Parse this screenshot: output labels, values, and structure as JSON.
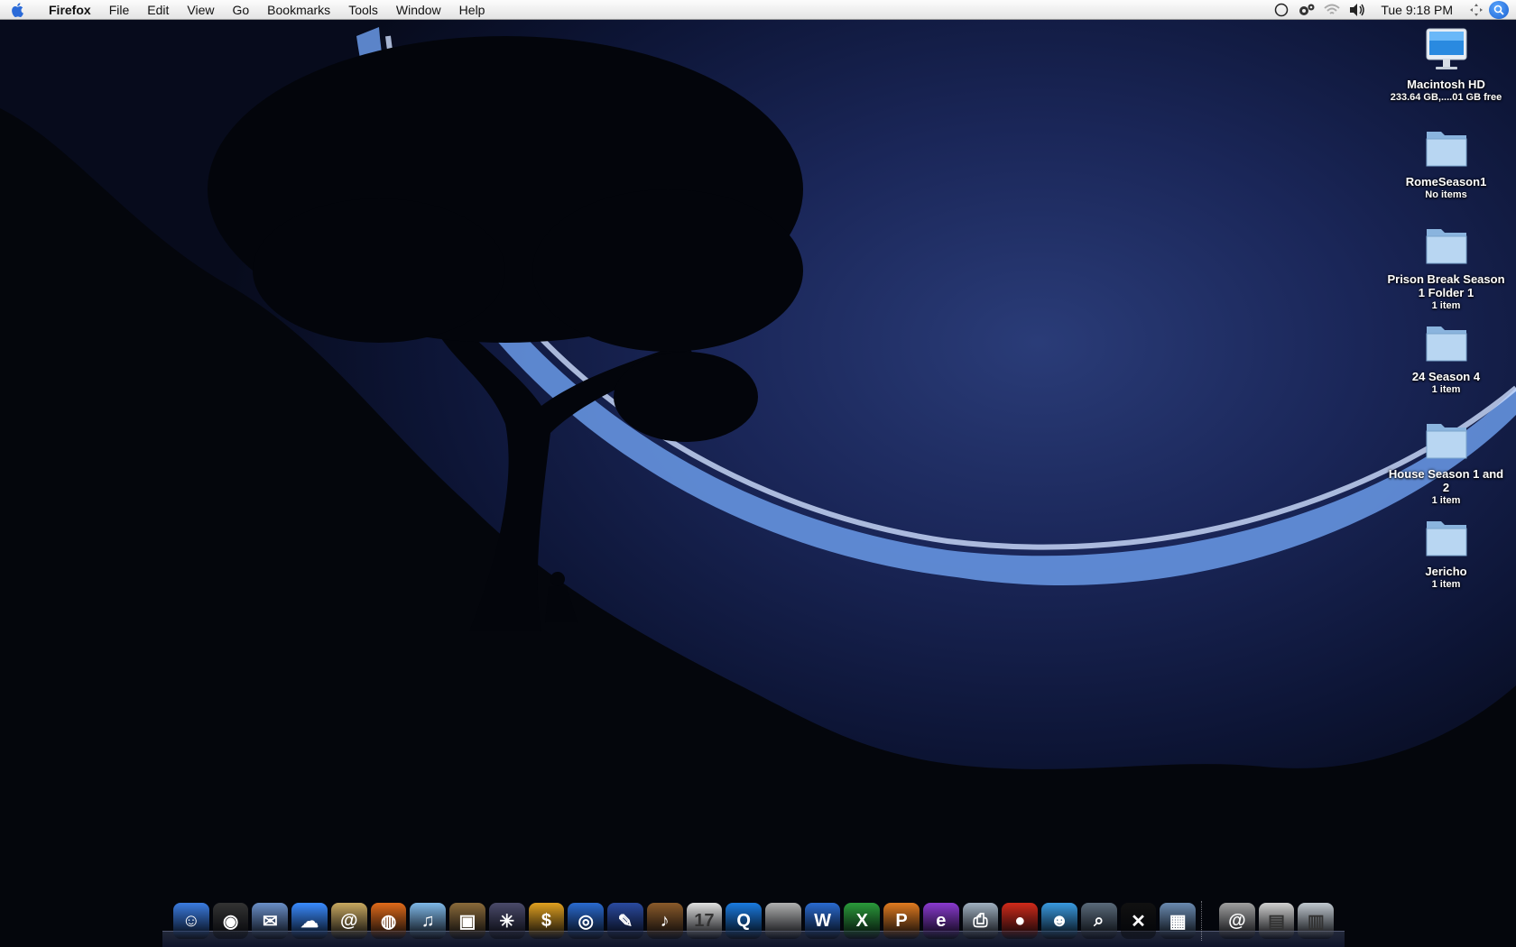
{
  "menubar": {
    "app_name": "Firefox",
    "menus": [
      "File",
      "Edit",
      "View",
      "Go",
      "Bookmarks",
      "Tools",
      "Window",
      "Help"
    ],
    "clock": "Tue 9:18 PM",
    "status_icons": [
      "circle-status-icon",
      "gears-icon",
      "wifi-icon",
      "volume-icon"
    ]
  },
  "desktop": {
    "icons": [
      {
        "name": "Macintosh HD",
        "sub": "233.64 GB,....01 GB free",
        "type": "drive"
      },
      {
        "name": "RomeSeason1",
        "sub": "No items",
        "type": "folder"
      },
      {
        "name": "Prison Break Season 1 Folder 1",
        "sub": "1 item",
        "type": "folder"
      },
      {
        "name": "24 Season 4",
        "sub": "1 item",
        "type": "folder"
      },
      {
        "name": "House Season 1 and 2",
        "sub": "1 item",
        "type": "folder"
      },
      {
        "name": "Jericho",
        "sub": "1 item",
        "type": "folder"
      }
    ]
  },
  "dock": {
    "apps": [
      {
        "icon": "finder-icon",
        "color": "#3b7be0",
        "glyph": "☺"
      },
      {
        "icon": "dashboard-icon",
        "color": "#333333",
        "glyph": "◉"
      },
      {
        "icon": "mail-icon",
        "color": "#6a8fc8",
        "glyph": "✉"
      },
      {
        "icon": "ichat-icon",
        "color": "#3a8bff",
        "glyph": "☁"
      },
      {
        "icon": "address-book-icon",
        "color": "#c8a860",
        "glyph": "@"
      },
      {
        "icon": "firefox-icon",
        "color": "#e06a1a",
        "glyph": "◍"
      },
      {
        "icon": "itunes-icon",
        "color": "#7fb8e8",
        "glyph": "♫"
      },
      {
        "icon": "iphoto-icon",
        "color": "#8a6a3a",
        "glyph": "▣"
      },
      {
        "icon": "imovie-icon",
        "color": "#4a4a6a",
        "glyph": "✳"
      },
      {
        "icon": "dollar-app-icon",
        "color": "#e0a020",
        "glyph": "$"
      },
      {
        "icon": "dvd-player-icon",
        "color": "#2a6ad0",
        "glyph": "◎"
      },
      {
        "icon": "xcode-icon",
        "color": "#2a4aa0",
        "glyph": "✎"
      },
      {
        "icon": "garageband-icon",
        "color": "#8a5a2a",
        "glyph": "♪"
      },
      {
        "icon": "ical-icon",
        "color": "#e0e0e0",
        "glyph": "17"
      },
      {
        "icon": "quicktime-icon",
        "color": "#1a7ae0",
        "glyph": "Q"
      },
      {
        "icon": "system-preferences-icon",
        "color": "#b0b0b0",
        "glyph": ""
      },
      {
        "icon": "word-icon",
        "color": "#2a6ad0",
        "glyph": "W"
      },
      {
        "icon": "excel-icon",
        "color": "#2a9a3a",
        "glyph": "X"
      },
      {
        "icon": "powerpoint-icon",
        "color": "#e07a20",
        "glyph": "P"
      },
      {
        "icon": "entourage-icon",
        "color": "#8a3ad0",
        "glyph": "e"
      },
      {
        "icon": "printer-icon",
        "color": "#a0b0c0",
        "glyph": "⎙"
      },
      {
        "icon": "tomato-app-icon",
        "color": "#d02a1a",
        "glyph": "●"
      },
      {
        "icon": "messenger-icon",
        "color": "#3a9ae0",
        "glyph": "☻"
      },
      {
        "icon": "preview-icon",
        "color": "#5a6a7a",
        "glyph": "⌕"
      },
      {
        "icon": "x11-icon",
        "color": "#111111",
        "glyph": "✕"
      },
      {
        "icon": "photo-app-icon",
        "color": "#6a8ab0",
        "glyph": "▦"
      }
    ],
    "docs": [
      {
        "icon": "at-sign-stack-icon",
        "color": "#a0a0a0",
        "glyph": "@"
      },
      {
        "icon": "documents-stack-icon",
        "color": "#d0d0d0",
        "glyph": "▤"
      },
      {
        "icon": "trash-icon",
        "color": "#c0c8d0",
        "glyph": "▥"
      }
    ]
  }
}
